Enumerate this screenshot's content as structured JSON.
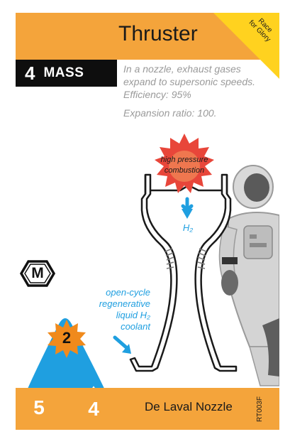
{
  "card": {
    "title": "Thruster",
    "corner_banner": "Race for Glory",
    "corner_banner_line1": "Race",
    "corner_banner_line2": "for Glory",
    "mass_value": "4",
    "mass_label": "MASS",
    "description_line1": "In a nozzle, exhaust gases",
    "description_line2": "expand to supersonic speeds.",
    "efficiency": "Efficiency: 95%",
    "expansion": "Expansion ratio: 100.",
    "combustion_label_line1": "high pressure",
    "combustion_label_line2": "combustion",
    "h2_label": "H₂",
    "coolant_label_line1": "open-cycle",
    "coolant_label_line2": "regenerative",
    "coolant_label_line3": "liquid H₂",
    "coolant_label_line4": "coolant",
    "type_icon_letter": "M",
    "cost_value": "2",
    "stat_left": "5",
    "stat_right": "4",
    "footer_label": "De Laval Nozzle",
    "card_id": "RT003F"
  },
  "colors": {
    "header_orange": "#f4a43b",
    "corner_yellow": "#ffd21f",
    "mass_black": "#0e0e0e",
    "accent_blue": "#1f9fe0",
    "cost_orange": "#f08a1c",
    "stat_magenta": "#e0007a",
    "burst_red": "#e8463a"
  },
  "icons": {
    "type": "m-hexagon-icon",
    "cost": "starburst-cost-icon",
    "water_drop": "water-drop-icon",
    "combustion": "starburst-icon",
    "arrow": "arrow-down-icon"
  }
}
